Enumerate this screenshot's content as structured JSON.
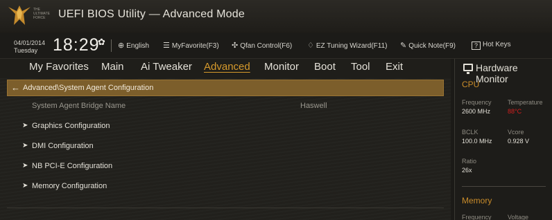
{
  "title": {
    "logo_text": "THE ULTIMATE FORCE",
    "app_title": "UEFI BIOS Utility — Advanced Mode"
  },
  "infobar": {
    "date": "04/01/2014",
    "day": "Tuesday",
    "time": "18:29",
    "language": "English",
    "myfavorite": "MyFavorite(F3)",
    "qfan": "Qfan Control(F6)",
    "ez_tuning": "EZ Tuning Wizard(F11)",
    "quick_note": "Quick Note(F9)",
    "hot_keys": "Hot Keys",
    "hot_keys_glyph": "?"
  },
  "menu": {
    "items": [
      {
        "label": "My Favorites"
      },
      {
        "label": "Main"
      },
      {
        "label": "Ai Tweaker"
      },
      {
        "label": "Advanced"
      },
      {
        "label": "Monitor"
      },
      {
        "label": "Boot"
      },
      {
        "label": "Tool"
      },
      {
        "label": "Exit"
      }
    ],
    "active_index": 3
  },
  "main": {
    "breadcrumb": "Advanced\\System Agent Configuration",
    "bridge_label": "System Agent Bridge Name",
    "bridge_value": "Haswell",
    "submenus": [
      {
        "label": "Graphics Configuration"
      },
      {
        "label": "DMI Configuration"
      },
      {
        "label": "NB PCI-E Configuration"
      },
      {
        "label": "Memory Configuration"
      }
    ]
  },
  "hardware_monitor": {
    "title": "Hardware Monitor",
    "cpu": {
      "section": "CPU",
      "frequency_label": "Frequency",
      "frequency_value": "2600 MHz",
      "temperature_label": "Temperature",
      "temperature_value": "88°C",
      "bclk_label": "BCLK",
      "bclk_value": "100.0 MHz",
      "vcore_label": "Vcore",
      "vcore_value": "0.928 V",
      "ratio_label": "Ratio",
      "ratio_value": "26x"
    },
    "memory": {
      "section": "Memory",
      "frequency_label": "Frequency",
      "voltage_label": "Voltage"
    }
  },
  "colors": {
    "accent": "#d69a2c",
    "breadcrumb_bg": "#7c5e2b",
    "hot": "#d21f1f"
  }
}
